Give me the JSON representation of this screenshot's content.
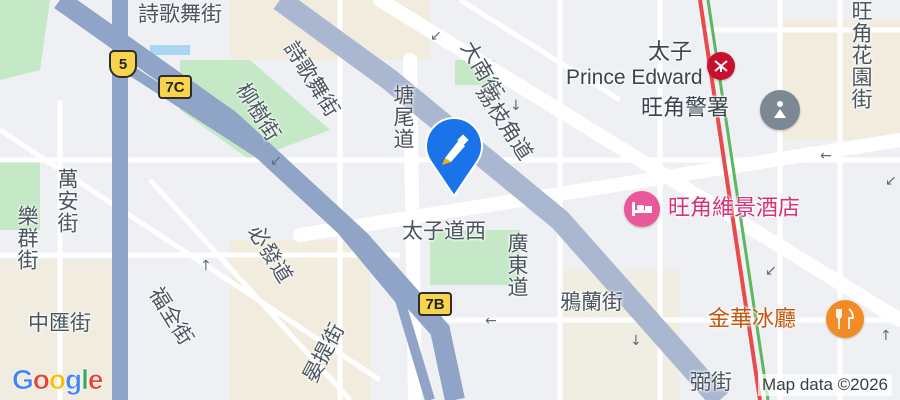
{
  "map": {
    "colors": {
      "background": "#eef0f3",
      "highway": "#8fa4c6",
      "major_road": "#ffffff",
      "park": "#c5e8c6",
      "block_tan": "#f2e9d4",
      "mtr_line": "#e64c4c",
      "marker": "#1a73e8"
    },
    "labels": {
      "poetry_dance_top": "詩歌舞街",
      "poetry_dance": "詩歌舞街",
      "willow_tree": "柳樹街",
      "tong_mi": "塘尾道",
      "tai_nan": "大南街",
      "lai_chi_kok": "荔枝角道",
      "prince_edward_west": "太子道西",
      "canton_road": "廣東道",
      "nga_lan": "鴉蘭街",
      "man_on": "萬安街",
      "lok_kwan": "樂群街",
      "chung_wui": "中匯街",
      "fuk_chuen": "福全街",
      "bute": "必發道",
      "tit_tai": "晏提街",
      "flower_garden": "旺角花園街",
      "bottom_right": "弼街"
    },
    "station": {
      "name_zh": "太子",
      "name_en": "Prince Edward",
      "icon": "mtr-icon"
    },
    "pois": [
      {
        "name": "旺角警署",
        "icon": "police-icon"
      },
      {
        "name": "旺角維景酒店",
        "icon": "hotel-icon"
      },
      {
        "name": "金華冰廳",
        "icon": "restaurant-icon"
      }
    ],
    "shields": {
      "route_5": "5",
      "exit_7c": "7C",
      "exit_7b": "7B"
    },
    "marker_icon": "pen-marker-icon",
    "logo": "Google",
    "attribution": "Map data ©2026"
  }
}
